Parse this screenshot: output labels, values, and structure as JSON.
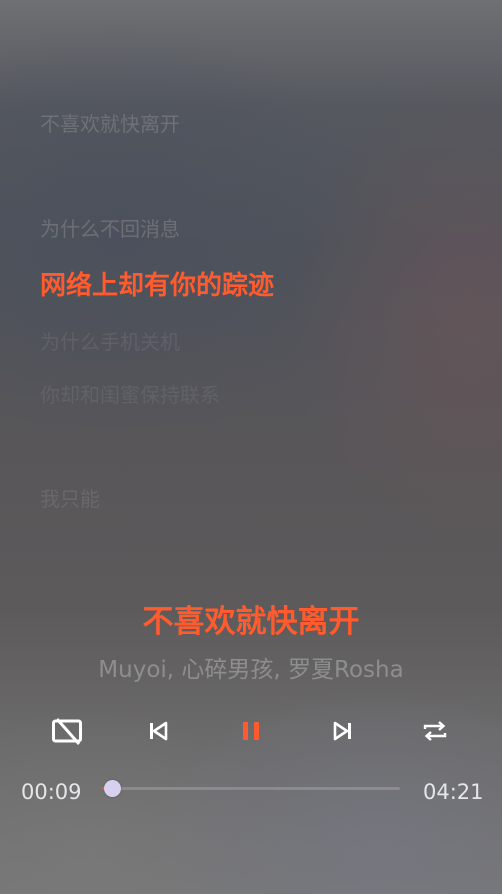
{
  "lyrics": [
    {
      "text": "不喜欢就快离开",
      "color": "#6f7178"
    },
    {
      "text": "为什么不回消息",
      "color": "#6d6f74"
    },
    {
      "text": "网络上却有你的踪迹",
      "color": "#ff5b2e"
    },
    {
      "text": "为什么手机关机",
      "color": "#5f6068"
    },
    {
      "text": "你却和闺蜜保持联系",
      "color": "#616268"
    },
    {
      "text": "我只能",
      "color": "#68696c"
    }
  ],
  "active_lyric_index": 2,
  "song": {
    "title": "不喜欢就快离开",
    "artist": "Muyoi, 心碎男孩, 罗夏Rosha"
  },
  "controls": {
    "lyrics_toggle_icon": "lyrics-off-icon",
    "previous_icon": "skip-previous-icon",
    "play_pause_icon": "pause-icon",
    "next_icon": "skip-next-icon",
    "repeat_icon": "repeat-icon"
  },
  "playback": {
    "current_time": "00:09",
    "total_time": "04:21",
    "progress_fraction": 0.034
  },
  "colors": {
    "accent": "#ff5b2e",
    "thumb": "#d7d0ee",
    "control_icon": "#ffffff"
  }
}
